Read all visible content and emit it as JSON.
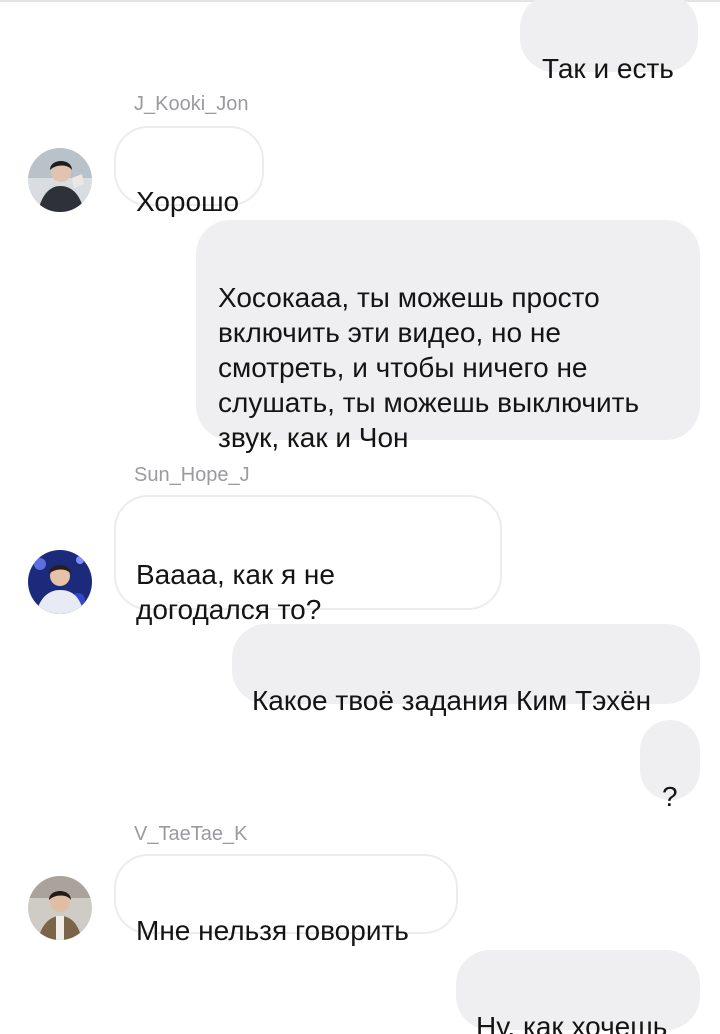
{
  "conversation": {
    "messages": [
      {
        "direction": "outgoing",
        "text": "Так и есть"
      },
      {
        "direction": "incoming",
        "sender": "J_Kooki_Jon",
        "avatar_icon": "profile-photo",
        "text": "Хорошо"
      },
      {
        "direction": "outgoing",
        "text": "Хосокааа, ты можешь просто\nвключить эти видео, но не\nсмотреть, и чтобы ничего не\nслушать, ты можешь выключить\nзвук, как и Чон"
      },
      {
        "direction": "incoming",
        "sender": "Sun_Hope_J",
        "avatar_icon": "profile-photo",
        "text": "Ваааа, как я не\nдогодался то?"
      },
      {
        "direction": "outgoing",
        "text": "Какое твоё задания Ким Тэхён"
      },
      {
        "direction": "outgoing",
        "text": "?"
      },
      {
        "direction": "incoming",
        "sender": "V_TaeTae_K",
        "avatar_icon": "profile-photo",
        "text": "Мне нельзя говорить"
      },
      {
        "direction": "outgoing",
        "text": "Ну, как хочешь"
      }
    ]
  },
  "theme": {
    "outgoing_bubble": "#efeff2",
    "incoming_border": "#ececee",
    "text": "#141414",
    "sender_name": "#9a9a9f"
  }
}
